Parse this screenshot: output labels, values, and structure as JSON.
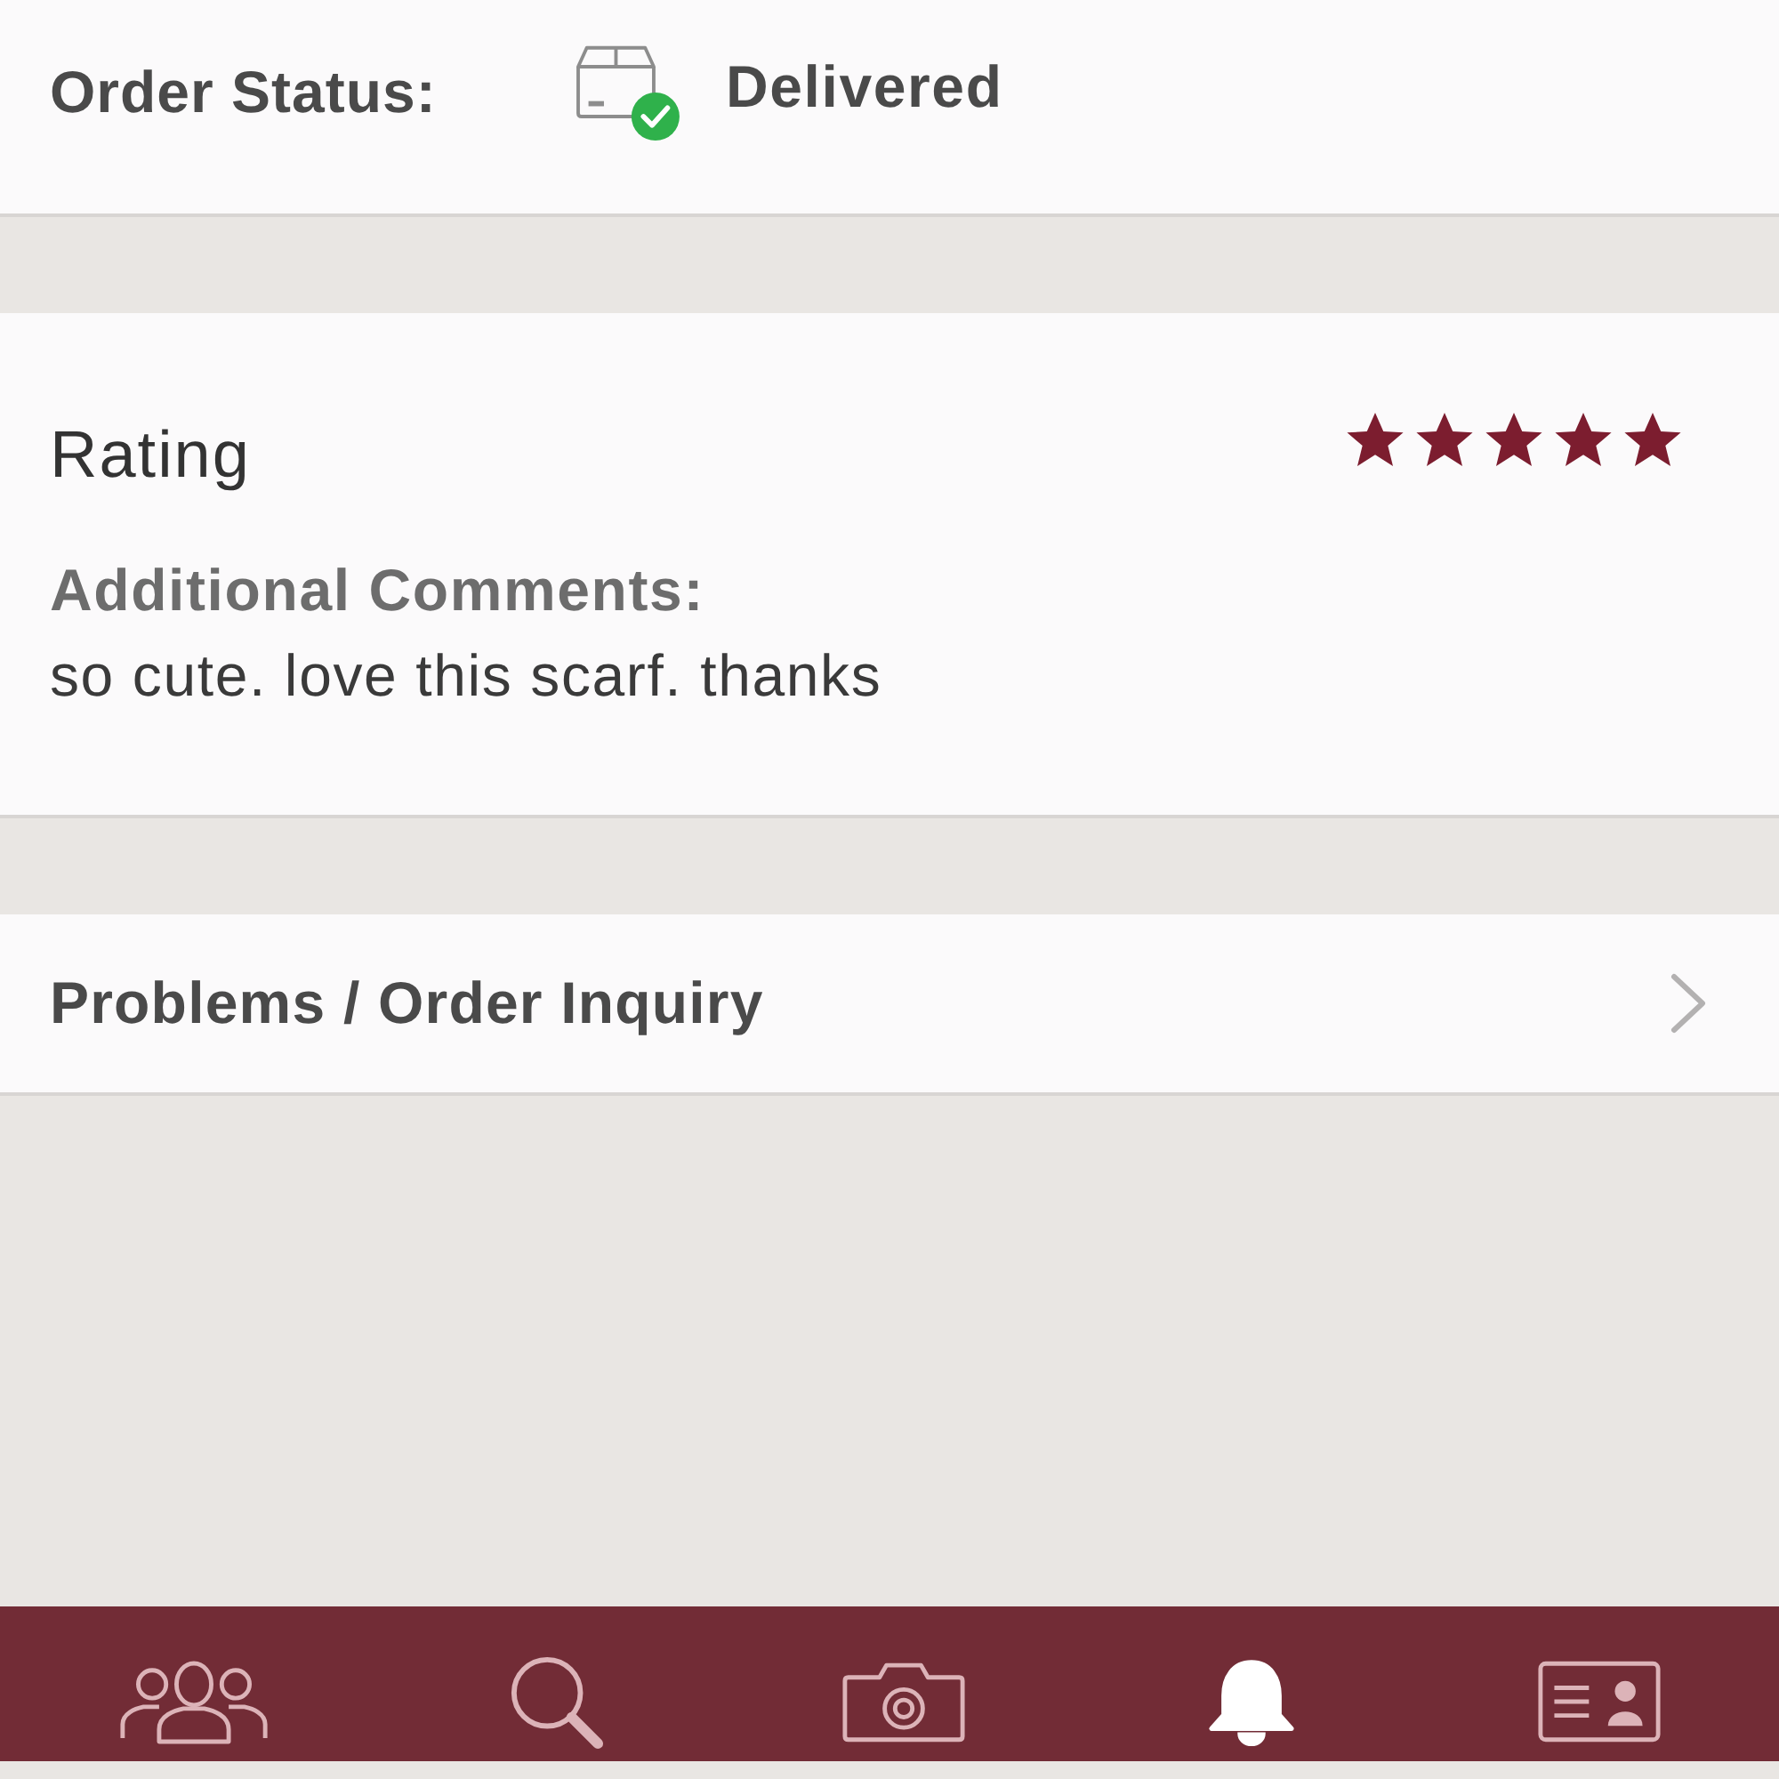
{
  "order_status": {
    "label": "Order Status:",
    "value": "Delivered"
  },
  "review": {
    "title": "Rating",
    "stars": 5,
    "comments_label": "Additional Comments:",
    "comment": "so cute. love this scarf. thanks"
  },
  "inquiry": {
    "label": "Problems / Order Inquiry"
  },
  "tab_bar": {
    "tabs": [
      {
        "kind": "people",
        "selected": false
      },
      {
        "kind": "search",
        "selected": false
      },
      {
        "kind": "camera",
        "selected": false
      },
      {
        "kind": "bell",
        "selected": true
      },
      {
        "kind": "card",
        "selected": false
      }
    ]
  }
}
